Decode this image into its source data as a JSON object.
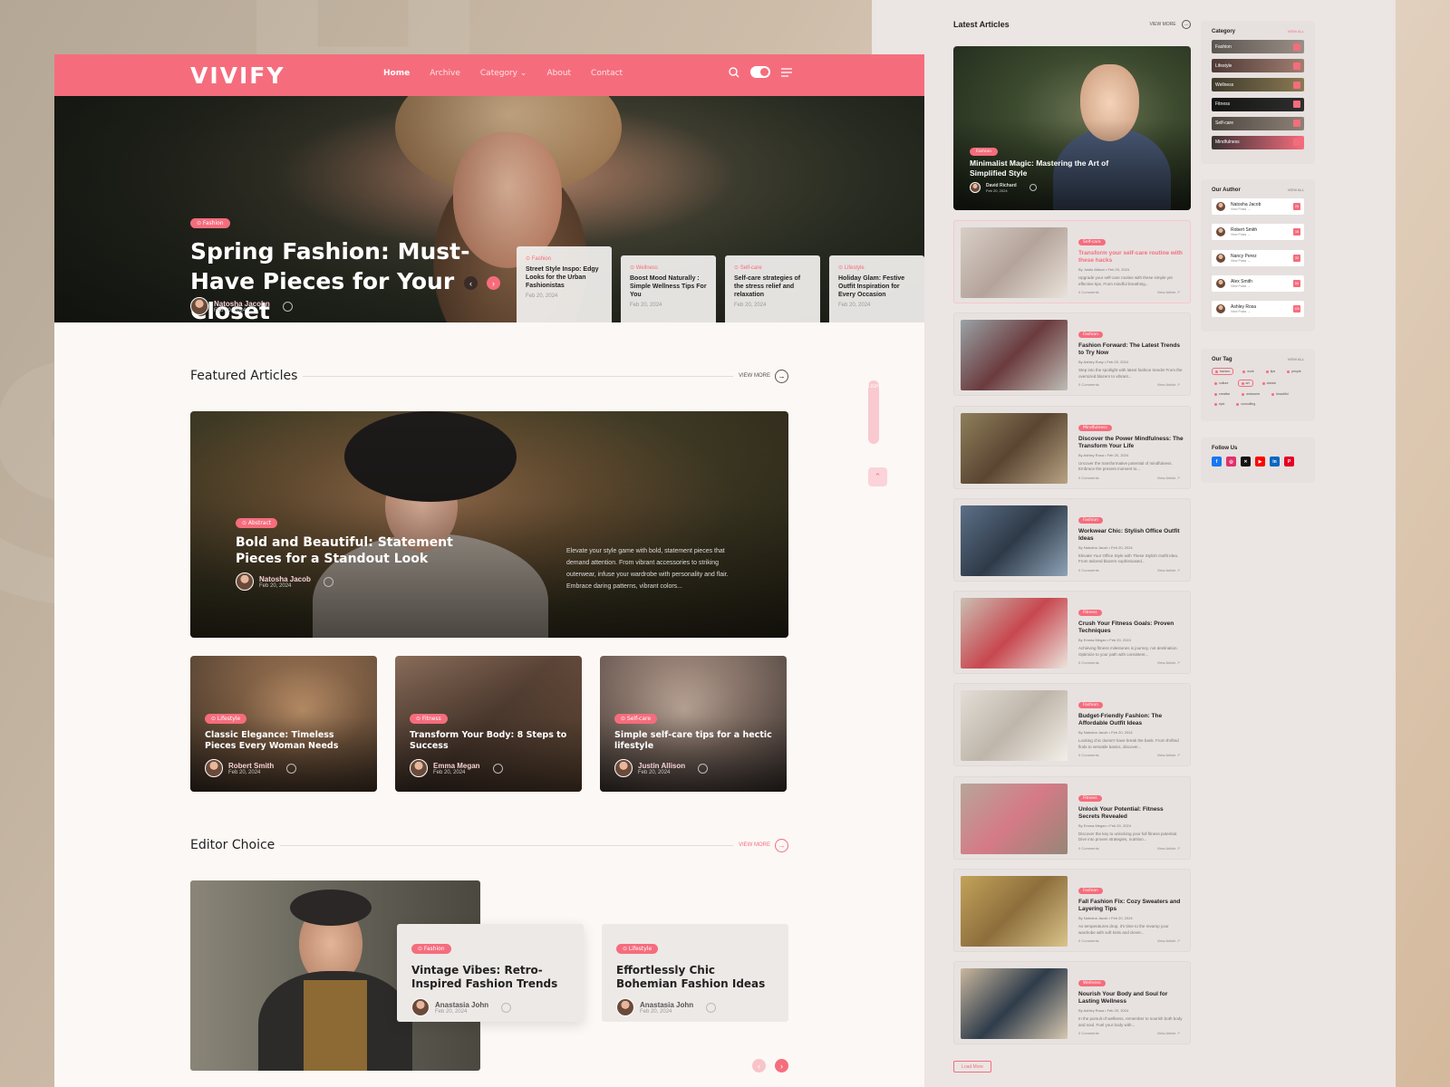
{
  "nav": {
    "logo": "VIVIFY",
    "items": [
      "Home",
      "Archive",
      "Category",
      "About",
      "Contact"
    ],
    "dropdown_arrow": "⌄"
  },
  "hero": {
    "tag": "⊙ Fashion",
    "title": "Spring Fashion: Must-Have Pieces for Your Closet",
    "author": "Natosha Jacobn",
    "date": "Feb 20, 2024",
    "slides": [
      {
        "cat": "⊙ Fashion",
        "title": "Street Style Inspo: Edgy Looks for the Urban Fashionistas",
        "date": "Feb 20, 2024"
      },
      {
        "cat": "⊙ Wellness",
        "title": "Boost Mood Naturally : Simple Wellness Tips For You",
        "date": "Feb 20, 2024"
      },
      {
        "cat": "⊙ Self-care",
        "title": "Self-care strategies of the stress relief and relaxation",
        "date": "Feb 20, 2024"
      },
      {
        "cat": "⊙ Lifestyle",
        "title": "Holiday Glam: Festive Outfit Inspiration for Every Occasion",
        "date": "Feb 20, 2024"
      }
    ]
  },
  "featured": {
    "heading": "Featured Articles",
    "view_more": "VIEW MORE",
    "main": {
      "tag": "⊙ Abstract",
      "title": "Bold and Beautiful: Statement Pieces for a Standout Look",
      "author": "Natosha Jacob",
      "date": "Feb 20, 2024",
      "desc": "Elevate your style game with bold, statement pieces that demand attention. From vibrant accessories to striking outerwear, infuse your wardrobe with personality and flair. Embrace daring patterns, vibrant colors..."
    },
    "cards": [
      {
        "tag": "⊙ Lifestyle",
        "title": "Classic Elegance: Timeless Pieces Every Woman Needs",
        "author": "Robert Smith",
        "date": "Feb 20, 2024"
      },
      {
        "tag": "⊙ Fitness",
        "title": "Transform Your Body: 8 Steps to Success",
        "author": "Emma Megan",
        "date": "Feb 20, 2024"
      },
      {
        "tag": "⊙ Self-care",
        "title": "Simple self-care tips for a hectic lifestyle",
        "author": "Justin Allison",
        "date": "Feb 20, 2024"
      }
    ]
  },
  "editor": {
    "heading": "Editor Choice",
    "view_more": "VIEW MORE",
    "items": [
      {
        "tag": "⊙ Fashion",
        "title": "Vintage Vibes: Retro-Inspired Fashion Trends",
        "author": "Anastasia John",
        "date": "Feb 20, 2024"
      },
      {
        "tag": "⊙ Lifestyle",
        "title": "Effortlessly Chic Bohemian Fashion Ideas",
        "author": "Anastasia John",
        "date": "Feb 20, 2024"
      }
    ]
  },
  "float": {
    "label": "LIGHT",
    "up": "⌃"
  },
  "latest": {
    "heading": "Latest Articles",
    "view_more": "VIEW MORE",
    "big": {
      "tag": "Fashion",
      "title": "Minimalist Magic: Mastering the Art of Simplified Style",
      "author": "David Richard",
      "date": "Feb 20, 2024"
    },
    "items": [
      {
        "tag": "Self-care",
        "title": "Transform your self-care routine with these hacks",
        "meta": "By Justin Allison  •  Feb 20, 2024",
        "desc": "Upgrade your self-care routine with these simple yet effective tips. From mindful breathing...",
        "comments": "0 Comments",
        "link": "View Article ↗",
        "highlight": true
      },
      {
        "tag": "Fashion",
        "title": "Fashion Forward: The Latest Trends to Try Now",
        "meta": "By Ashley Rosy  •  Feb 20, 2024",
        "desc": "Step into the spotlight with latest fashion trends! From the oversized blazers to vibrant...",
        "comments": "0 Comments",
        "link": "View Article ↗"
      },
      {
        "tag": "Mindfulness",
        "title": "Discover the Power Mindfulness: The Transform Your Life",
        "meta": "By Ashley Rosa  •  Feb 20, 2024",
        "desc": "Uncover the transformative potential of mindfulness. Embrace the present moment to...",
        "comments": "0 Comments",
        "link": "View Article ↗"
      },
      {
        "tag": "Fashion",
        "title": "Workwear Chic: Stylish Office Outfit Ideas",
        "meta": "By Natosha Jacob  •  Feb 20, 2024",
        "desc": "Elevate Your Office Style with These Stylish Outfit Idea. From tailored blazers sophisticated...",
        "comments": "0 Comments",
        "link": "View Article ↗"
      },
      {
        "tag": "Fitness",
        "title": "Crush Your Fitness Goals: Proven Techniques",
        "meta": "By Emma Megan  •  Feb 20, 2024",
        "desc": "Achieving fitness milestones is journey, not destination. Optimize to your path with consistent...",
        "comments": "0 Comments",
        "link": "View Article ↗"
      },
      {
        "tag": "Fashion",
        "title": "Budget-Friendly Fashion: The Affordable Outfit Ideas",
        "meta": "By Natosha Jacob  •  Feb 20, 2024",
        "desc": "Looking chic doesn't have break the bank. From thrifted finds to versatile basics, discover...",
        "comments": "0 Comments",
        "link": "View Article ↗"
      },
      {
        "tag": "Fitness",
        "title": "Unlock Your Potential: Fitness Secrets Revealed",
        "meta": "By Emma Megan  •  Feb 20, 2024",
        "desc": "Discover the key to unlocking your full fitness potential. Dive into proven strategies, nutrition...",
        "comments": "0 Comments",
        "link": "View Article ↗"
      },
      {
        "tag": "Fashion",
        "title": "Fall Fashion Fix: Cozy Sweaters and Layering Tips",
        "meta": "By Natosha Jacob  •  Feb 20, 2024",
        "desc": "As temperatures drop, it's time to the revamp your wardrobe with soft knits and clever...",
        "comments": "0 Comments",
        "link": "View Article ↗"
      },
      {
        "tag": "Wellness",
        "title": "Nourish Your Body and Soul for Lasting Wellness",
        "meta": "By Ashley Rosa  •  Feb 20, 2024",
        "desc": "In the pursuit of wellness, remember to nourish both body and soul. Fuel your body with...",
        "comments": "0 Comments",
        "link": "View Article ↗"
      }
    ],
    "load_more": "Load More"
  },
  "category": {
    "heading": "Category",
    "view_all": "VIEW ALL",
    "items": [
      "Fashion",
      "Lifestyle",
      "Wellness",
      "Fitness",
      "Self-care",
      "Mindfulness"
    ]
  },
  "authors": {
    "heading": "Our Author",
    "view_all": "VIEW ALL",
    "view_posts": "View Posts →",
    "items": [
      {
        "name": "Natosha Jacob",
        "count": "26"
      },
      {
        "name": "Robert Smith",
        "count": "18"
      },
      {
        "name": "Nancy Perez",
        "count": "30"
      },
      {
        "name": "Alex Smith",
        "count": "54"
      },
      {
        "name": "Ashley Rosa",
        "count": "120"
      }
    ]
  },
  "tags": {
    "heading": "Our Tag",
    "view_all": "VIEW ALL",
    "items": [
      "fashion",
      "work",
      "tips",
      "people",
      "culture",
      "art",
      "classic",
      "creative",
      "awesome",
      "beautiful",
      "epic",
      "consulting"
    ]
  },
  "follow": {
    "heading": "Follow Us",
    "items": [
      {
        "name": "facebook-icon",
        "glyph": "f",
        "color": "#1877f2"
      },
      {
        "name": "instagram-icon",
        "glyph": "◎",
        "color": "#e1306c"
      },
      {
        "name": "x-icon",
        "glyph": "✕",
        "color": "#111111"
      },
      {
        "name": "youtube-icon",
        "glyph": "▶",
        "color": "#ff0000"
      },
      {
        "name": "linkedin-icon",
        "glyph": "in",
        "color": "#0a66c2"
      },
      {
        "name": "pinterest-icon",
        "glyph": "P",
        "color": "#e60023"
      }
    ]
  },
  "colors": {
    "accent": "#f56d7d",
    "page_bg": "#fcf8f5",
    "sidebar_bg": "#ebe5e3"
  }
}
